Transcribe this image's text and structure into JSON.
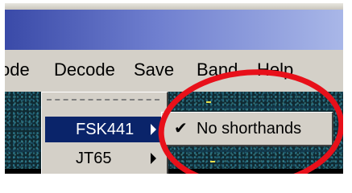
{
  "menubar": {
    "items": [
      "ode",
      "Decode",
      "Save",
      "Band",
      "Help"
    ]
  },
  "decode_menu": {
    "items": [
      {
        "label": "FSK441",
        "selected": true
      },
      {
        "label": "JT65",
        "selected": false
      }
    ]
  },
  "submenu": {
    "item": {
      "label": "No shorthands",
      "checked": true,
      "check_glyph": "✔"
    }
  },
  "colors": {
    "highlight": "#0a246a",
    "annotation": "#e8101a",
    "titlebar_start": "#3a4aa8",
    "waterfall": "#102a32"
  },
  "icons": {
    "check": "checkmark-icon",
    "submenu_arrow": "submenu-arrow-icon"
  }
}
